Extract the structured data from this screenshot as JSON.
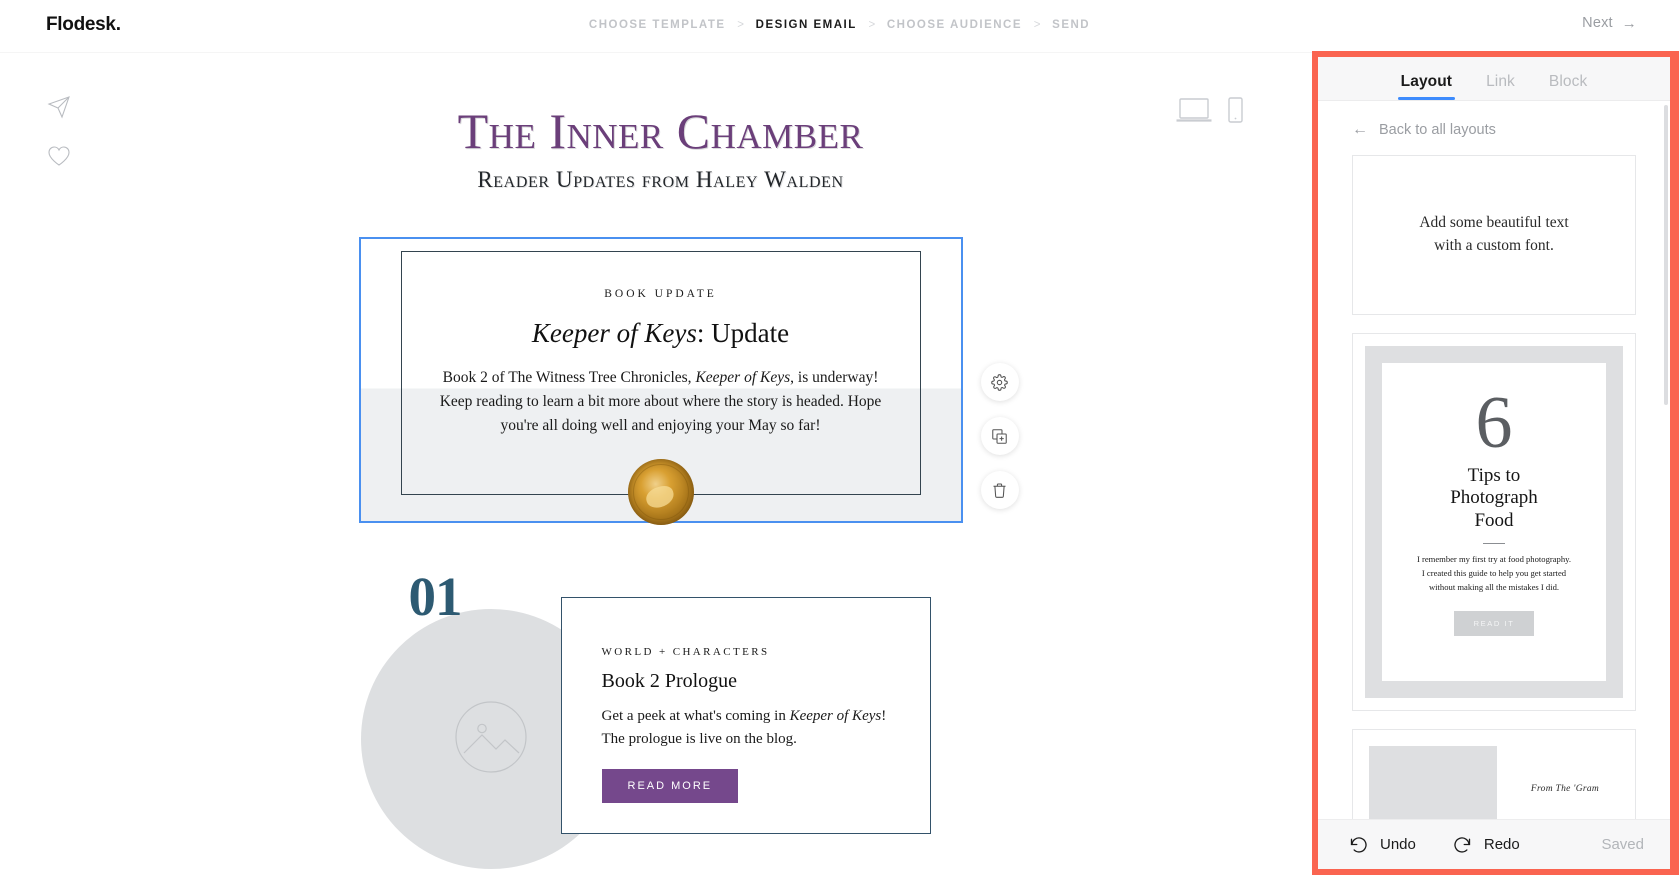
{
  "brand": "Flodesk.",
  "steps": [
    {
      "label": "CHOOSE TEMPLATE",
      "active": false
    },
    {
      "label": "DESIGN EMAIL",
      "active": true
    },
    {
      "label": "CHOOSE AUDIENCE",
      "active": false
    },
    {
      "label": "SEND",
      "active": false
    }
  ],
  "step_separator": ">",
  "next": {
    "label": "Next",
    "arrow": "→"
  },
  "left_rail": [
    {
      "icon": "send-test-icon"
    },
    {
      "icon": "favorite-heart-icon"
    }
  ],
  "device_toggle": [
    {
      "icon": "desktop-preview-icon",
      "active": true
    },
    {
      "icon": "mobile-preview-icon",
      "active": false
    }
  ],
  "email": {
    "masthead": {
      "title": "The Inner Chamber",
      "subtitle": "Reader Updates from Haley Walden",
      "title_color": "#6b3f7a"
    },
    "selected_block": {
      "eyebrow": "BOOK UPDATE",
      "heading_italic": "Keeper of Keys",
      "heading_rest": ": Update",
      "body_part1": "Book 2 of The Witness Tree Chronicles, ",
      "body_italic": "Keeper of Keys",
      "body_part2": ", is underway! Keep reading to learn a bit more about where the story is headed. Hope you're all doing well and enjoying your May so far!",
      "emblem": "gold-wax-seal",
      "selection_color": "#4a90f0"
    },
    "block_actions": [
      {
        "icon": "gear-icon",
        "label": "Settings"
      },
      {
        "icon": "duplicate-icon",
        "label": "Duplicate"
      },
      {
        "icon": "trash-icon",
        "label": "Delete"
      }
    ],
    "section_01": {
      "number": "01",
      "number_color": "#2d5a72",
      "image_placeholder": "image-placeholder-icon",
      "eyebrow": "WORLD + CHARACTERS",
      "title": "Book 2 Prologue",
      "body_part1": "Get a peek at what's coming in ",
      "body_italic": "Keeper of Keys",
      "body_part2": "! The prologue is live on the blog.",
      "button_label": "READ MORE",
      "button_color": "#75488c"
    }
  },
  "panel": {
    "highlight_color": "#fa6450",
    "tabs": [
      {
        "label": "Layout",
        "active": true
      },
      {
        "label": "Link",
        "active": false
      },
      {
        "label": "Block",
        "active": false
      }
    ],
    "back": {
      "arrow": "←",
      "label": "Back to all layouts"
    },
    "layout_cards": [
      {
        "id": "text-layout",
        "line1": "Add some beautiful text",
        "line2": "with a custom font."
      },
      {
        "id": "numbered-tips-layout",
        "number": "6",
        "title_line1": "Tips to",
        "title_line2": "Photograph",
        "title_line3": "Food",
        "body_line1": "I remember my first try at food photography.",
        "body_line2": "I created this guide to help you get started",
        "body_line3": "without making all the mistakes I did.",
        "button_label": "READ IT"
      },
      {
        "id": "image-text-layout",
        "caption": "From The 'Gram"
      }
    ],
    "footer": {
      "undo": "Undo",
      "redo": "Redo",
      "status": "Saved"
    }
  }
}
